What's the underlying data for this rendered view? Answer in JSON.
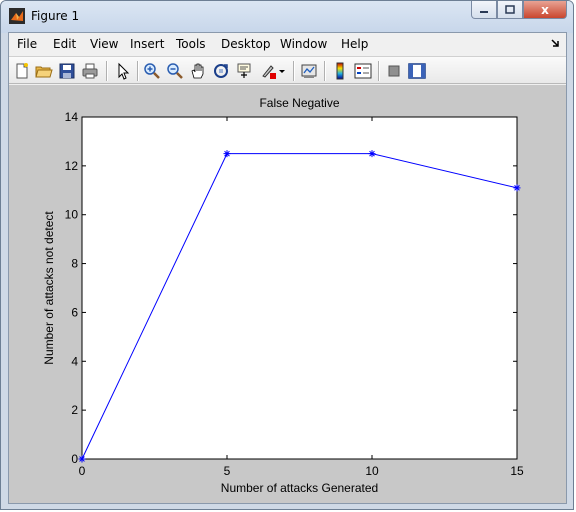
{
  "window": {
    "title": "Figure 1",
    "minimize_icon": "minimize-icon",
    "maximize_icon": "maximize-icon",
    "close_label": "x"
  },
  "menu": {
    "items": [
      "File",
      "Edit",
      "View",
      "Insert",
      "Tools",
      "Desktop",
      "Window",
      "Help"
    ],
    "dock_icon": "dock-arrow-icon"
  },
  "toolbar": {
    "icons": [
      "new-figure-icon",
      "open-file-icon",
      "save-icon",
      "print-icon",
      "edit-plot-icon",
      "zoom-in-icon",
      "zoom-out-icon",
      "pan-icon",
      "rotate-3d-icon",
      "data-cursor-icon",
      "brush-icon",
      "link-plot-icon",
      "colorbar-icon",
      "legend-icon",
      "hide-plot-tools-icon",
      "show-plot-tools-icon"
    ]
  },
  "colors": {
    "line": "#0000ff",
    "figure_bg": "#c8c8c8",
    "axes_bg": "#ffffff"
  },
  "chart_data": {
    "type": "line",
    "title": "False Negative",
    "xlabel": "Number of attacks Generated",
    "ylabel": "Number of attacks not detect",
    "xlim": [
      0,
      15
    ],
    "ylim": [
      0,
      14
    ],
    "xticks": [
      "0",
      "5",
      "10",
      "15"
    ],
    "yticks": [
      "0",
      "2",
      "4",
      "6",
      "8",
      "10",
      "12",
      "14"
    ],
    "marker": "*",
    "grid": false,
    "series": [
      {
        "x": [
          0,
          5,
          10,
          15
        ],
        "y": [
          0,
          12.5,
          12.5,
          11.1
        ]
      }
    ]
  }
}
